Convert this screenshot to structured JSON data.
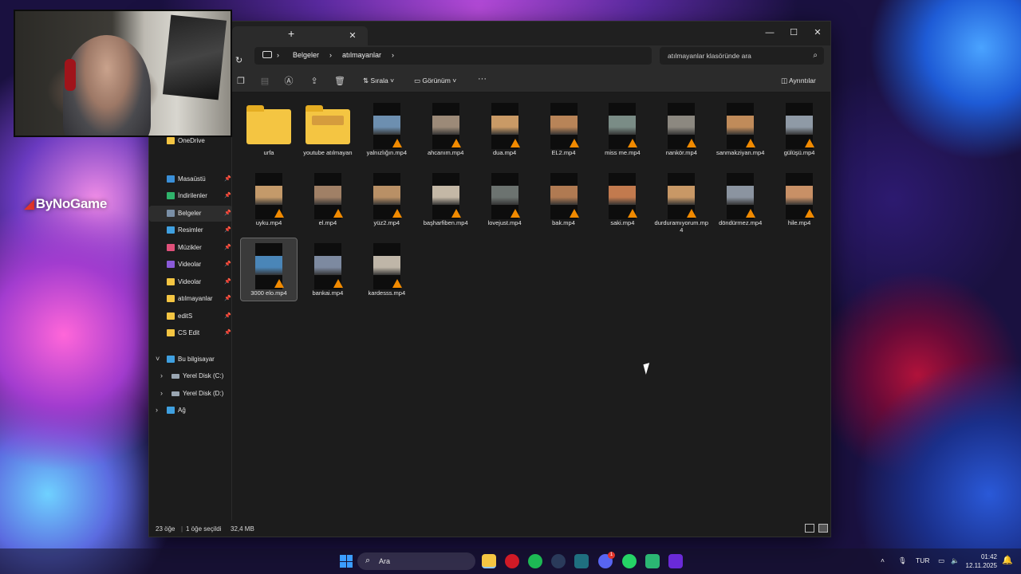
{
  "brand": {
    "name": "ByNoGame"
  },
  "window": {
    "tab_close": "✕",
    "new_tab": "+",
    "controls": {
      "minimize": "—",
      "maximize": "☐",
      "close": "✕"
    }
  },
  "address": {
    "crumbs": [
      "Belgeler",
      "atılmayanlar"
    ],
    "separator": "›",
    "search_placeholder": "atılmayanlar klasöründe ara"
  },
  "toolbar": {
    "sort_label": "Sırala",
    "view_label": "Görünüm",
    "more_label": "···",
    "details_label": "Ayrıntılar"
  },
  "sidebar": {
    "onedrive": "OneDrive",
    "quick": [
      {
        "label": "Masaüstü",
        "color": "#3a8fd8"
      },
      {
        "label": "İndirilenler",
        "color": "#2fb36b"
      },
      {
        "label": "Belgeler",
        "color": "#7a8fa6"
      },
      {
        "label": "Resimler",
        "color": "#3fa0e0"
      },
      {
        "label": "Müzikler",
        "color": "#e0507a"
      },
      {
        "label": "Videolar",
        "color": "#8a5ad8"
      },
      {
        "label": "Videolar",
        "color": "#f4c542"
      },
      {
        "label": "atılmayanlar",
        "color": "#f4c542"
      },
      {
        "label": "editS",
        "color": "#f4c542"
      },
      {
        "label": "CS Edit",
        "color": "#f4c542"
      }
    ],
    "this_pc": "Bu bilgisayar",
    "drives": [
      "Yerel Disk (C:)",
      "Yerel Disk (D:)"
    ],
    "network": "Ağ"
  },
  "files": [
    {
      "name": "urfa",
      "type": "folder"
    },
    {
      "name": "youtube atılmayan",
      "type": "folder"
    },
    {
      "name": "yalnızlığın.mp4",
      "type": "video",
      "tint": "#6d8fb0"
    },
    {
      "name": "ahcanım.mp4",
      "type": "video",
      "tint": "#9c8a78"
    },
    {
      "name": "dua.mp4",
      "type": "video",
      "tint": "#c99a66"
    },
    {
      "name": "EL2.mp4",
      "type": "video",
      "tint": "#b88458"
    },
    {
      "name": "miss me.mp4",
      "type": "video",
      "tint": "#7a8c86"
    },
    {
      "name": "nankör.mp4",
      "type": "video",
      "tint": "#8c8880"
    },
    {
      "name": "sanmakziyan.mp4",
      "type": "video",
      "tint": "#c08b5a"
    },
    {
      "name": "gülüşü.mp4",
      "type": "video",
      "tint": "#8f9aa6"
    },
    {
      "name": "uyku.mp4",
      "type": "video",
      "tint": "#c49a6a"
    },
    {
      "name": "el.mp4",
      "type": "video",
      "tint": "#a08066"
    },
    {
      "name": "yüz2.mp4",
      "type": "video",
      "tint": "#b99066"
    },
    {
      "name": "başharfiben.mp4",
      "type": "video",
      "tint": "#c4b8a6"
    },
    {
      "name": "lovejust.mp4",
      "type": "video",
      "tint": "#6c7370"
    },
    {
      "name": "bak.mp4",
      "type": "video",
      "tint": "#b07a52"
    },
    {
      "name": "saki.mp4",
      "type": "video",
      "tint": "#c27a4e"
    },
    {
      "name": "durduramıyorum.mp4",
      "type": "video",
      "tint": "#c89866"
    },
    {
      "name": "döndürmez.mp4",
      "type": "video",
      "tint": "#8b94a0"
    },
    {
      "name": "hile.mp4",
      "type": "video",
      "tint": "#c89066"
    },
    {
      "name": "3000 elo.mp4",
      "type": "video",
      "tint": "#4a86b8",
      "selected": true
    },
    {
      "name": "bankai.mp4",
      "type": "video",
      "tint": "#7d8aa0"
    },
    {
      "name": "kardesss.mp4",
      "type": "video",
      "tint": "#bfb6a8"
    }
  ],
  "status": {
    "count": "23 öğe",
    "selected": "1 öğe seçildi",
    "size": "32,4 MB"
  },
  "taskbar": {
    "search": "Ara",
    "lang": "TUR",
    "time": "01:42",
    "date": "12.11.2025",
    "discord_badge": "1"
  }
}
